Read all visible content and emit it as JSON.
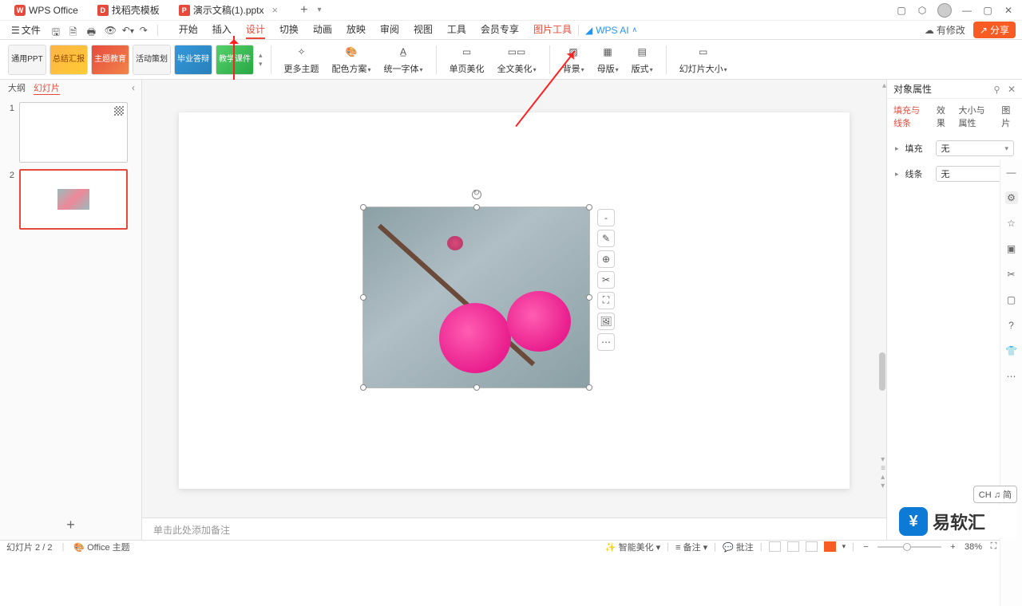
{
  "title_tabs": [
    {
      "icon": "W",
      "label": "WPS Office",
      "closable": false
    },
    {
      "icon": "D",
      "label": "找稻壳模板",
      "closable": false
    },
    {
      "icon": "P",
      "label": "演示文稿(1).pptx",
      "closable": true,
      "active": true
    }
  ],
  "menu": {
    "file": "文件",
    "tabs": [
      "开始",
      "插入",
      "设计",
      "切换",
      "动画",
      "放映",
      "审阅",
      "视图",
      "工具",
      "会员专享",
      "图片工具"
    ],
    "active": "设计",
    "orange": "图片工具",
    "wps_ai": "WPS AI",
    "modified": "有修改",
    "share": "分享"
  },
  "qat": {
    "save": "保存",
    "saveas": "另存",
    "print": "打印",
    "preview": "预览",
    "undo": "撤销",
    "redo": "重做"
  },
  "ribbon": {
    "templates": [
      "通用PPT",
      "总结汇报",
      "主题教育",
      "活动策划",
      "毕业答辩",
      "教学课件"
    ],
    "buttons": {
      "more_theme": "更多主题",
      "color_scheme": "配色方案",
      "unify_font": "统一字体",
      "page_beautify": "单页美化",
      "full_beautify": "全文美化",
      "background": "背景",
      "master": "母版",
      "layout": "版式",
      "slide_size": "幻灯片大小"
    }
  },
  "left_panel": {
    "tabs": [
      "大纲",
      "幻灯片"
    ],
    "active": "幻灯片",
    "slides": [
      1,
      2
    ],
    "selected": 2
  },
  "float_tools": [
    "-",
    "✎",
    "⊕",
    "✂",
    "⛶",
    "🖼",
    "⋯"
  ],
  "notes_placeholder": "单击此处添加备注",
  "right_panel": {
    "title": "对象属性",
    "tabs": [
      "填充与线条",
      "效果",
      "大小与属性",
      "图片"
    ],
    "active": "填充与线条",
    "fill_label": "填充",
    "fill_value": "无",
    "line_label": "线条",
    "line_value": "无"
  },
  "status": {
    "slide_pos": "幻灯片 2 / 2",
    "theme": "Office 主题",
    "ai_beautify": "智能美化",
    "notes_toggle": "备注",
    "comments": "批注",
    "zoom": "38%"
  },
  "ime": "CH ♫ 简",
  "watermark": "易软汇"
}
